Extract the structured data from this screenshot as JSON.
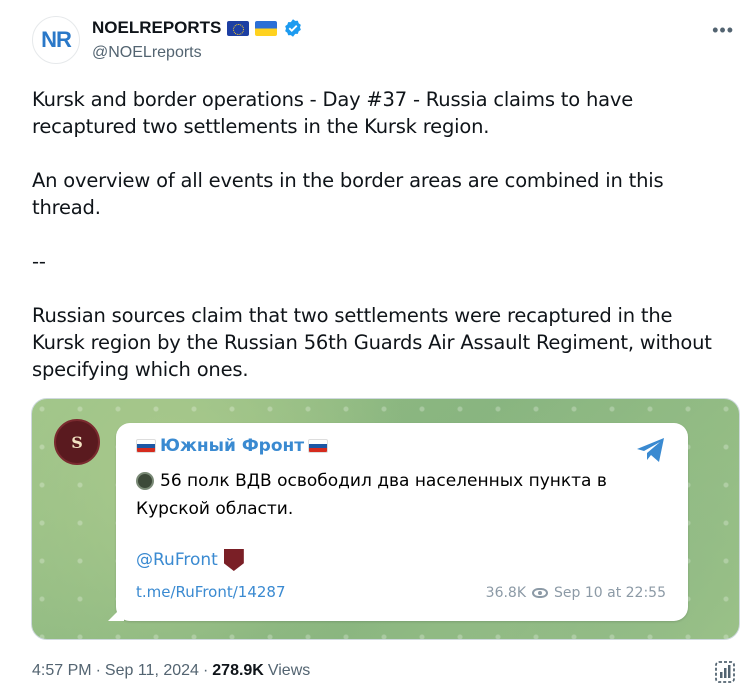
{
  "author": {
    "display_name": "NOELREPORTS",
    "handle": "@NOELreports",
    "avatar_text": "NR",
    "flags": [
      "eu-flag",
      "ukraine-flag"
    ],
    "verified": true
  },
  "tweet": {
    "line1": "Kursk and border operations - Day #37 - Russia claims to have",
    "line2": "recaptured two settlements in the Kursk region.",
    "line3": "An overview of all events in the border areas are combined in this thread.",
    "line4": "--",
    "line5": "Russian sources claim that two settlements were recaptured in the",
    "line6": "Kursk region by the Russian 56th Guards Air Assault Regiment, without",
    "line7": "specifying which ones."
  },
  "media": {
    "channel_name": "Южный Фронт",
    "message_line1": "56 полк ВДВ освободил два населенных пункта в",
    "message_line2": "Курской области.",
    "mention": "@RuFront",
    "link": "t.me/RuFront/14287",
    "views": "36.8K",
    "date": "Sep 10 at 22:55",
    "avatar_letter": "S"
  },
  "footer": {
    "time": "4:57 PM",
    "separator1": "·",
    "date": "Sep 11, 2024",
    "separator2": "·",
    "views_count": "278.9K",
    "views_label": "Views"
  },
  "colors": {
    "text": "#0f1419",
    "secondary": "#536471",
    "verified_blue": "#1d9bf0",
    "telegram_blue": "#3a8ad1"
  }
}
